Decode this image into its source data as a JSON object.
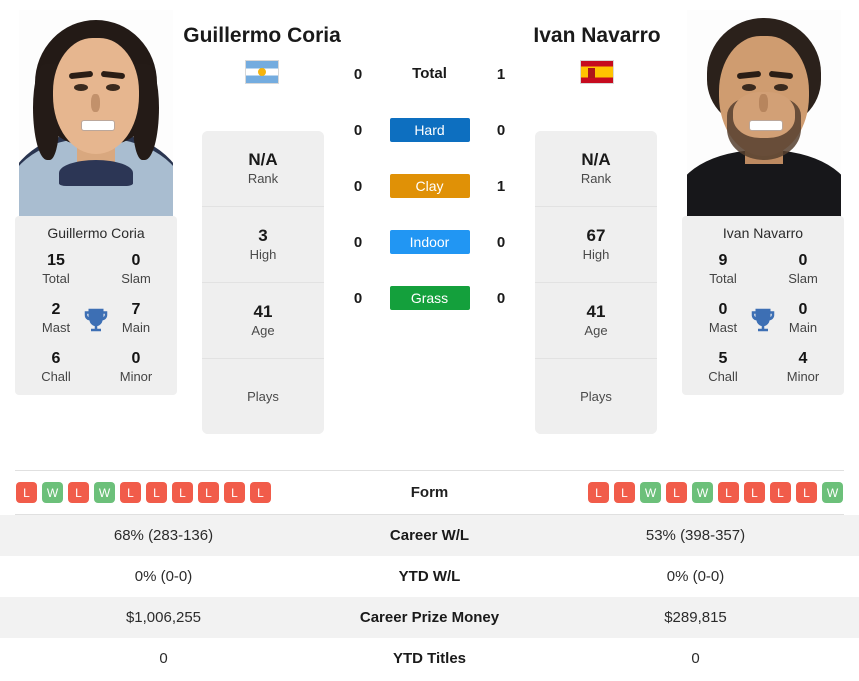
{
  "players": {
    "left": {
      "name": "Guillermo Coria",
      "flag": "argentina-flag",
      "card_name": "Guillermo Coria",
      "rank": "N/A",
      "rank_label": "Rank",
      "high": "3",
      "high_label": "High",
      "age": "41",
      "age_label": "Age",
      "plays": "",
      "plays_label": "Plays",
      "titles": {
        "total": "15",
        "total_label": "Total",
        "slam": "0",
        "slam_label": "Slam",
        "mast": "2",
        "mast_label": "Mast",
        "main": "7",
        "main_label": "Main",
        "chall": "6",
        "chall_label": "Chall",
        "minor": "0",
        "minor_label": "Minor"
      },
      "form": [
        "L",
        "W",
        "L",
        "W",
        "L",
        "L",
        "L",
        "L",
        "L",
        "L"
      ],
      "career_wl": "68% (283-136)",
      "ytd_wl": "0% (0-0)",
      "career_prize_money": "$1,006,255",
      "ytd_titles": "0"
    },
    "right": {
      "name": "Ivan Navarro",
      "flag": "spain-flag",
      "card_name": "Ivan Navarro",
      "rank": "N/A",
      "rank_label": "Rank",
      "high": "67",
      "high_label": "High",
      "age": "41",
      "age_label": "Age",
      "plays": "",
      "plays_label": "Plays",
      "titles": {
        "total": "9",
        "total_label": "Total",
        "slam": "0",
        "slam_label": "Slam",
        "mast": "0",
        "mast_label": "Mast",
        "main": "0",
        "main_label": "Main",
        "chall": "5",
        "chall_label": "Chall",
        "minor": "4",
        "minor_label": "Minor"
      },
      "form": [
        "L",
        "L",
        "W",
        "L",
        "W",
        "L",
        "L",
        "L",
        "L",
        "W"
      ],
      "career_wl": "53% (398-357)",
      "ytd_wl": "0% (0-0)",
      "career_prize_money": "$289,815",
      "ytd_titles": "0"
    }
  },
  "h2h": [
    {
      "key": "total",
      "label": "Total",
      "left": "0",
      "right": "1",
      "type": "text"
    },
    {
      "key": "hard",
      "label": "Hard",
      "left": "0",
      "right": "0",
      "type": "badge",
      "color": "#0d6fc0"
    },
    {
      "key": "clay",
      "label": "Clay",
      "left": "0",
      "right": "1",
      "type": "badge",
      "color": "#e09106"
    },
    {
      "key": "indoor",
      "label": "Indoor",
      "left": "0",
      "right": "0",
      "type": "badge",
      "color": "#2196f3"
    },
    {
      "key": "grass",
      "label": "Grass",
      "left": "0",
      "right": "0",
      "type": "badge",
      "color": "#14a03c"
    }
  ],
  "form_row": {
    "label": "Form",
    "win_color": "#6cc07a",
    "loss_color": "#f15c4a"
  },
  "table_rows": [
    {
      "label": "Career W/L",
      "left": "68% (283-136)",
      "right": "53% (398-357)"
    },
    {
      "label": "YTD W/L",
      "left": "0% (0-0)",
      "right": "0% (0-0)"
    },
    {
      "label": "Career Prize Money",
      "left": "$1,006,255",
      "right": "$289,815"
    },
    {
      "label": "YTD Titles",
      "left": "0",
      "right": "0"
    }
  ],
  "colors": {
    "trophy": "#3d6fb4",
    "panel_bg": "#efefef",
    "row_alt_bg": "#f2f2f2"
  }
}
